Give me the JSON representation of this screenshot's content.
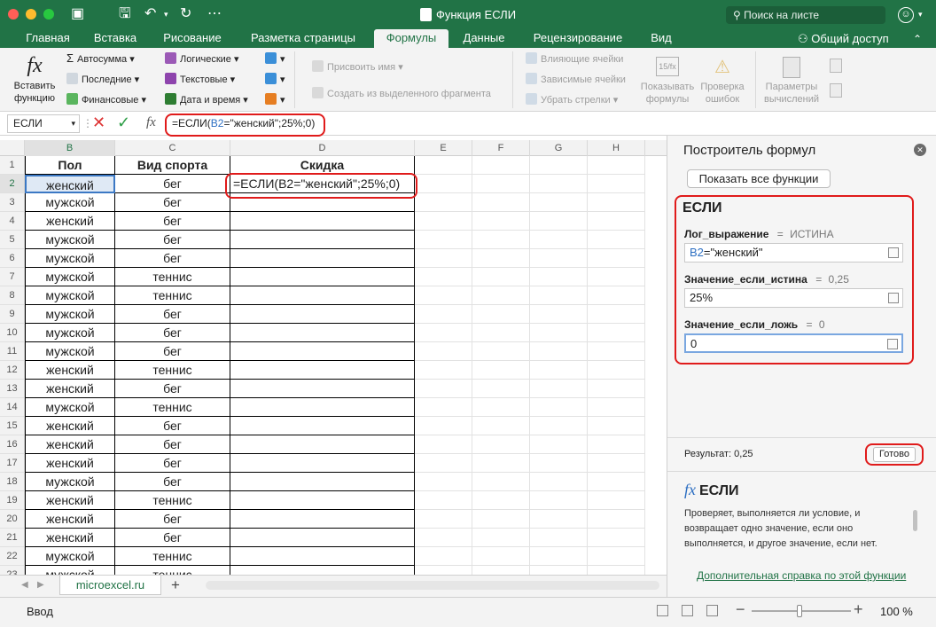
{
  "window": {
    "title": "Функция ЕСЛИ",
    "search_placeholder": "Поиск на листе"
  },
  "ribbon_tabs": [
    "Главная",
    "Вставка",
    "Рисование",
    "Разметка страницы",
    "Формулы",
    "Данные",
    "Рецензирование",
    "Вид"
  ],
  "active_tab": "Формулы",
  "share_label": "Общий доступ",
  "ribbon": {
    "insert_function": [
      "Вставить",
      "функцию"
    ],
    "autosum": "Автосумма",
    "recent": "Последние",
    "financial": "Финансовые",
    "logical": "Логические",
    "text": "Текстовые",
    "datetime": "Дата и время",
    "assign_name": "Присвоить имя",
    "create_from_selection": "Создать из выделенного фрагмента",
    "trace_precedents": "Влияющие ячейки",
    "trace_dependents": "Зависимые ячейки",
    "remove_arrows": "Убрать стрелки",
    "show_formulas": [
      "Показывать",
      "формулы"
    ],
    "error_checking": [
      "Проверка",
      "ошибок"
    ],
    "calc_options": [
      "Параметры",
      "вычислений"
    ]
  },
  "formula_bar": {
    "name_box": "ЕСЛИ",
    "fx": "fx",
    "formula_prefix": "=ЕСЛИ(",
    "formula_ref": "B2",
    "formula_suffix": "=\"женский\";25%;0)"
  },
  "columns": [
    "B",
    "C",
    "D",
    "E",
    "F",
    "G",
    "H"
  ],
  "rows": [
    1,
    2,
    3,
    4,
    5,
    6,
    7,
    8,
    9,
    10,
    11,
    12,
    13,
    14,
    15,
    16,
    17,
    18,
    19,
    20,
    21,
    22,
    23
  ],
  "headers": {
    "B": "Пол",
    "C": "Вид спорта",
    "D": "Скидка"
  },
  "data": [
    [
      "женский",
      "бег"
    ],
    [
      "мужской",
      "бег"
    ],
    [
      "женский",
      "бег"
    ],
    [
      "мужской",
      "бег"
    ],
    [
      "мужской",
      "бег"
    ],
    [
      "мужской",
      "теннис"
    ],
    [
      "мужской",
      "теннис"
    ],
    [
      "мужской",
      "бег"
    ],
    [
      "мужской",
      "бег"
    ],
    [
      "мужской",
      "бег"
    ],
    [
      "женский",
      "теннис"
    ],
    [
      "женский",
      "бег"
    ],
    [
      "мужской",
      "теннис"
    ],
    [
      "женский",
      "бег"
    ],
    [
      "женский",
      "бег"
    ],
    [
      "женский",
      "бег"
    ],
    [
      "мужской",
      "бег"
    ],
    [
      "женский",
      "теннис"
    ],
    [
      "женский",
      "бег"
    ],
    [
      "женский",
      "бег"
    ],
    [
      "мужской",
      "теннис"
    ],
    [
      "мужской",
      "теннис"
    ]
  ],
  "d2_formula": "=ЕСЛИ(B2=\"женский\";25%;0)",
  "sheet_tab": "microexcel.ru",
  "status": {
    "mode": "Ввод",
    "zoom": "100 %"
  },
  "panel": {
    "title": "Построитель формул",
    "show_all": "Показать все функции",
    "func_name": "ЕСЛИ",
    "args": [
      {
        "label": "Лог_выражение",
        "eq": "=",
        "value": "ИСТИНА",
        "input_ref": "B2",
        "input_rest": "=\"женский\""
      },
      {
        "label": "Значение_если_истина",
        "eq": "=",
        "value": "0,25",
        "input_ref": "",
        "input_rest": "25%"
      },
      {
        "label": "Значение_если_ложь",
        "eq": "=",
        "value": "0",
        "input_ref": "",
        "input_rest": "0"
      }
    ],
    "result_label": "Результат: 0,25",
    "done": "Готово",
    "help_fx": "fx",
    "help_title": "ЕСЛИ",
    "help_text": "Проверяет, выполняется ли условие, и возвращает одно значение, если оно выполняется, и другое значение, если нет.",
    "help_link": "Дополнительная справка по этой функции"
  },
  "colors": {
    "accent": "#217346",
    "highlight": "#e01b1b",
    "link": "#217346"
  }
}
